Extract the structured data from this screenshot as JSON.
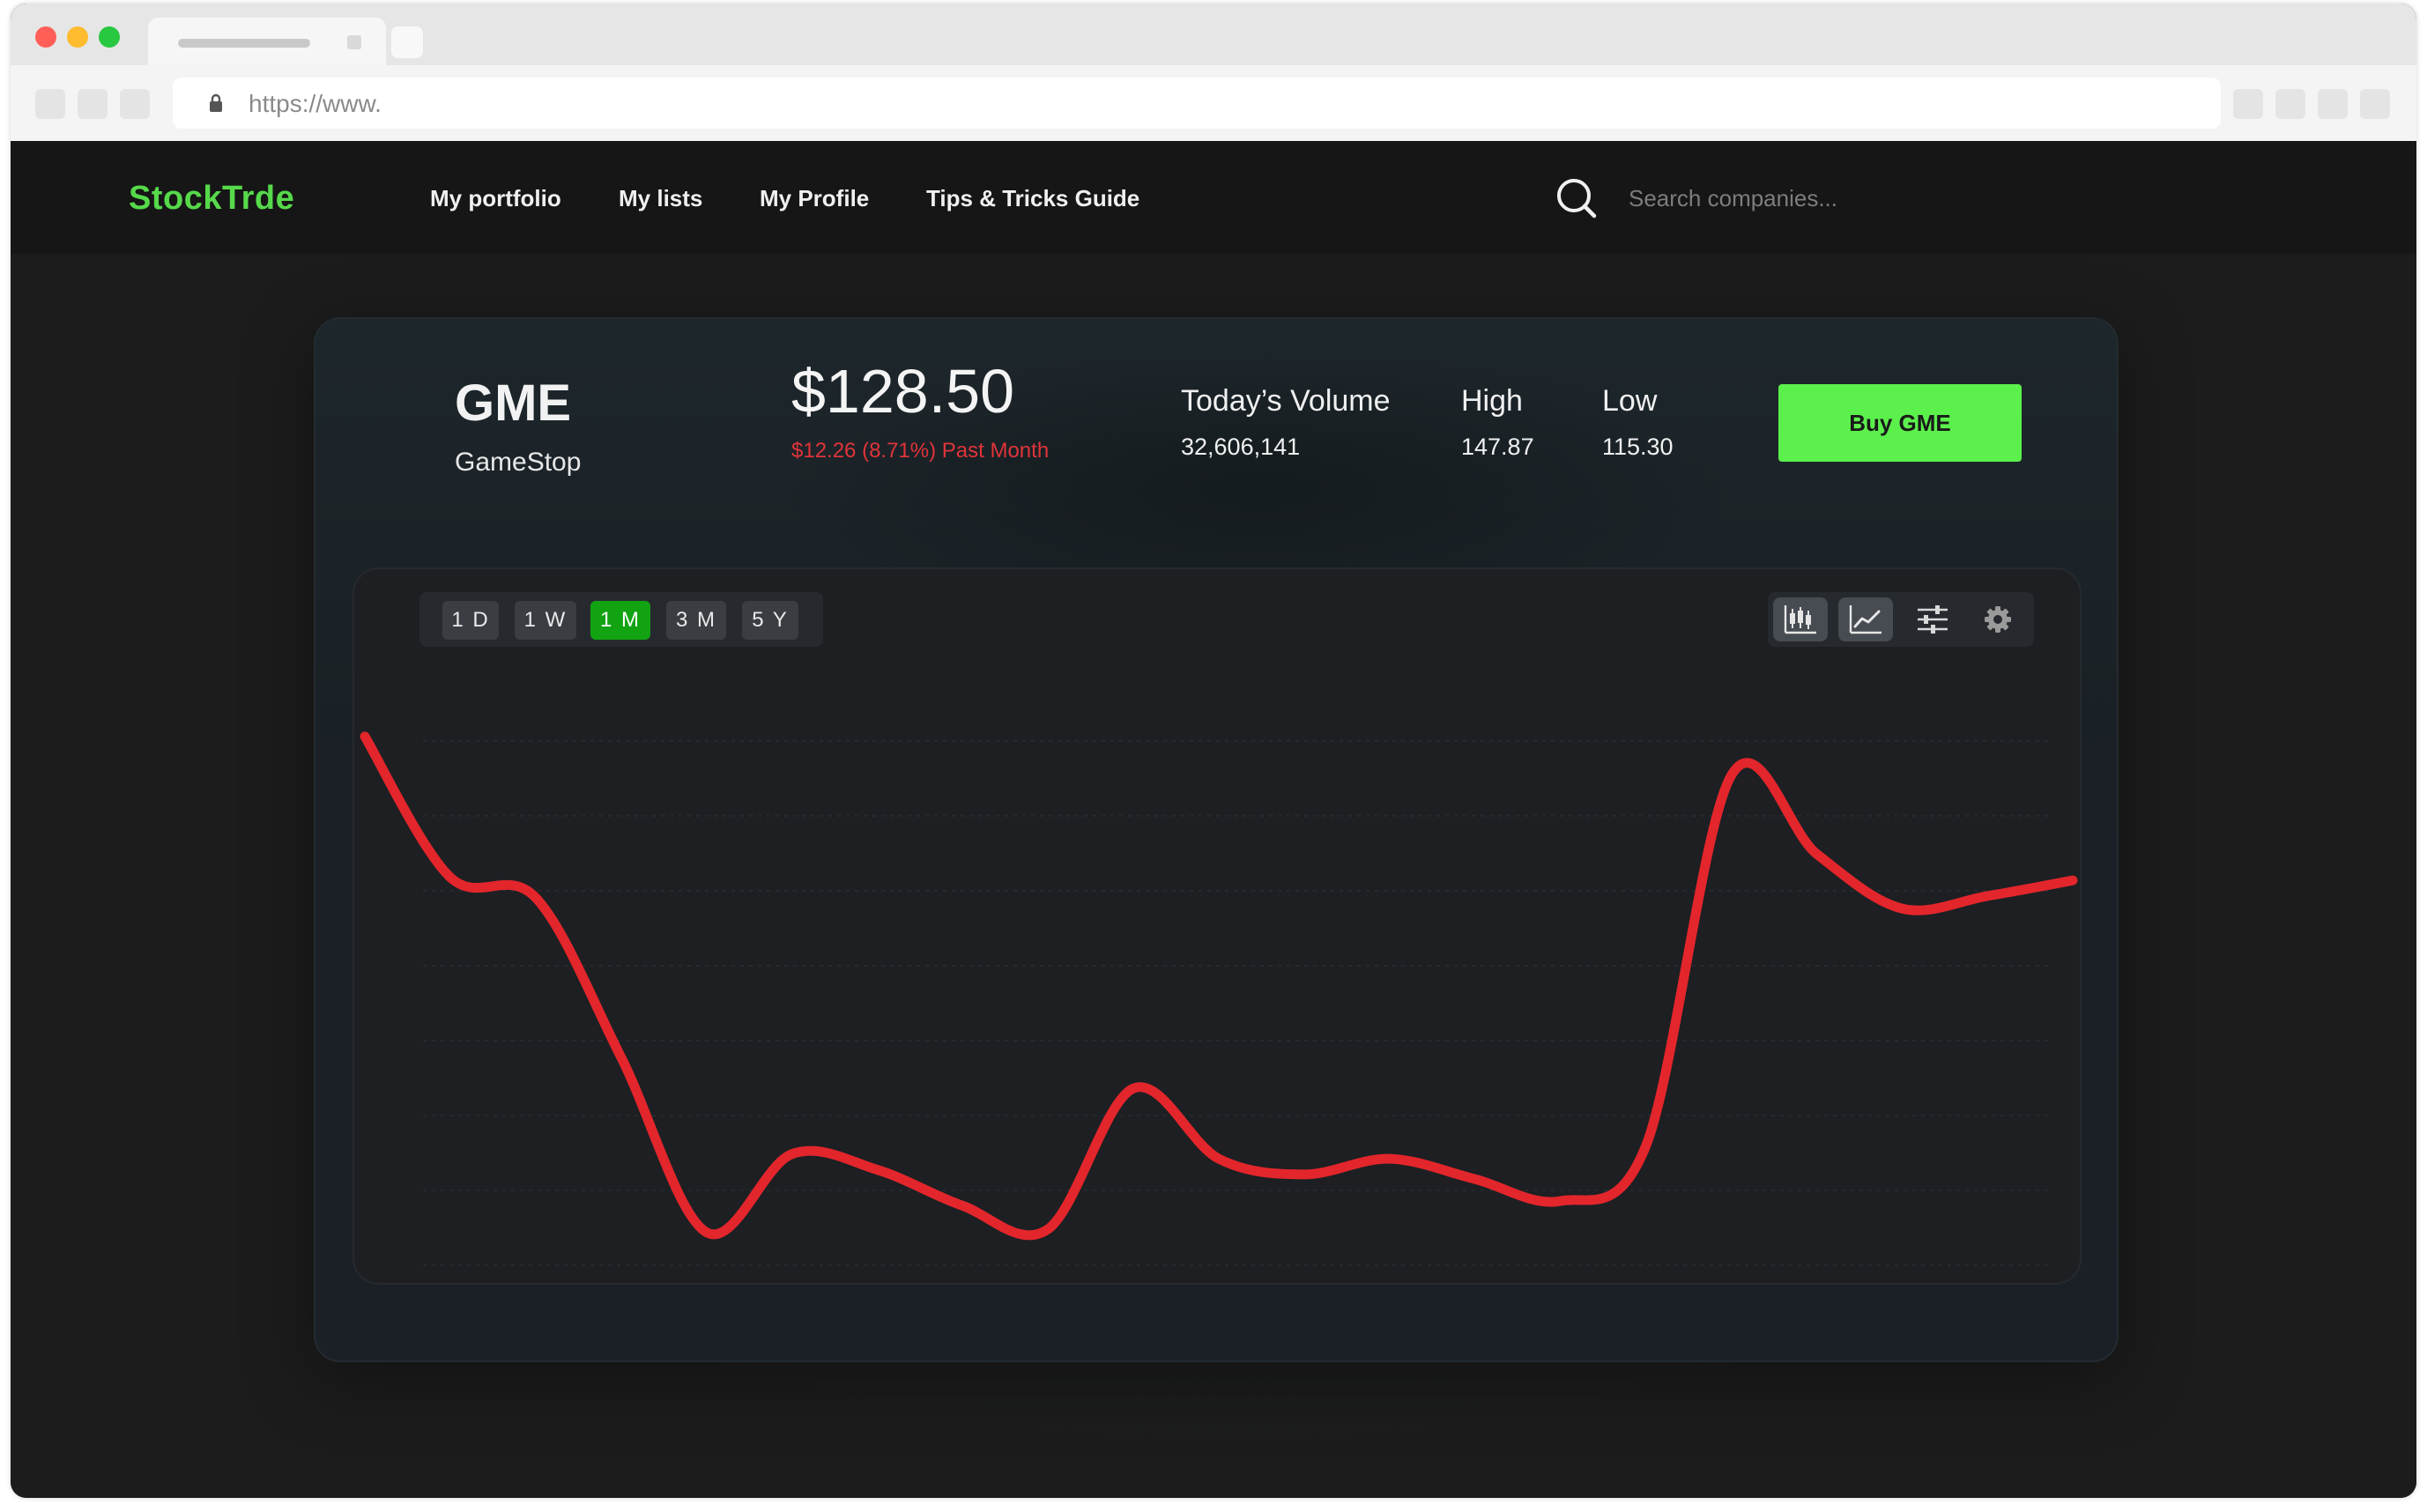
{
  "browser": {
    "url": "https://www."
  },
  "navbar": {
    "logo": "StockTrde",
    "links": [
      "My portfolio",
      "My lists",
      "My Profile",
      "Tips & Tricks Guide"
    ],
    "search_placeholder": "Search companies..."
  },
  "stock": {
    "ticker": "GME",
    "company": "GameStop",
    "price": "$128.50",
    "change": "$12.26 (8.71%) Past Month",
    "volume_label": "Today’s Volume",
    "volume_value": "32,606,141",
    "high_label": "High",
    "high_value": "147.87",
    "low_label": "Low",
    "low_value": "115.30",
    "buy_label": "Buy GME"
  },
  "chart": {
    "ranges": [
      "1 D",
      "1 W",
      "1 M",
      "3 M",
      "5 Y"
    ],
    "active_range": "1 M",
    "tools": [
      "candlestick-icon",
      "line-chart-icon",
      "sliders-icon",
      "gear-icon"
    ],
    "active_tools": [
      "candlestick-icon",
      "line-chart-icon"
    ]
  },
  "colors": {
    "accent": "#5bf04c",
    "logo": "#56d94a",
    "negative": "#e0343a",
    "active_range": "#12a312",
    "line": "#e2262c"
  },
  "chart_data": {
    "type": "line",
    "x": [
      0,
      1,
      2,
      3,
      4,
      5,
      6,
      7,
      8,
      9,
      10,
      11,
      12,
      13,
      14,
      15,
      16,
      17,
      18,
      19,
      20
    ],
    "series": [
      {
        "values": [
          147.5,
          138.5,
          137.2,
          127.0,
          115.8,
          120.8,
          119.8,
          117.5,
          116.0,
          125.0,
          120.5,
          119.5,
          120.5,
          119.2,
          117.8,
          121.3,
          145.0,
          140.0,
          136.5,
          137.3,
          138.3
        ]
      }
    ],
    "ylim": [
      112,
      152
    ],
    "grid": true
  }
}
